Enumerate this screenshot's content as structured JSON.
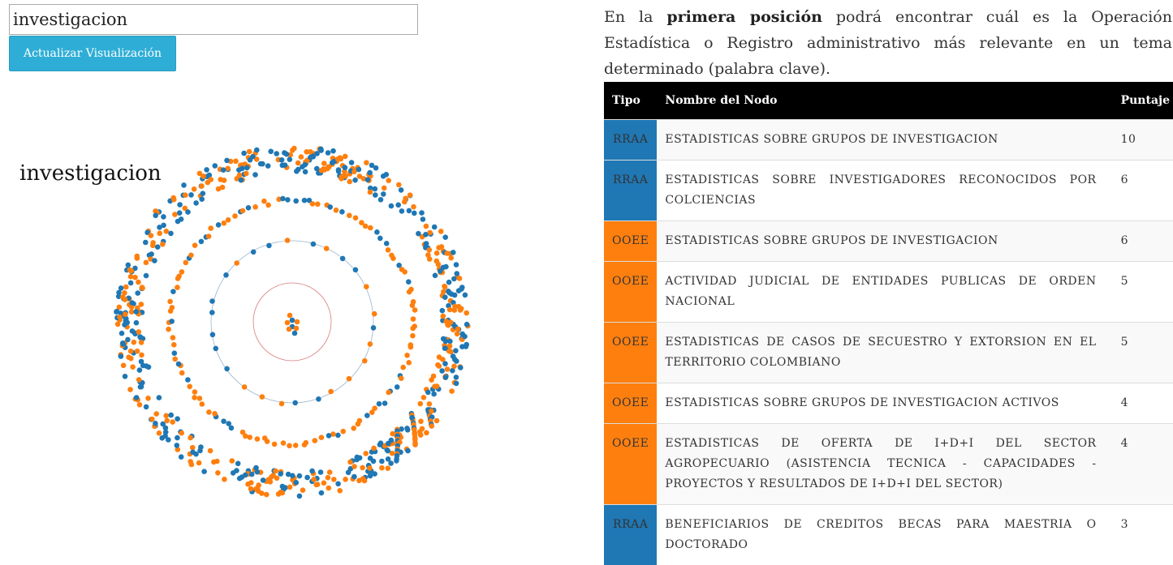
{
  "search": {
    "value": "investigacion"
  },
  "update_button": {
    "label": "Actualizar Visualización"
  },
  "viz": {
    "keyword": "investigacion"
  },
  "intro": {
    "part1": "En la ",
    "bold": "primera posición",
    "part2": " podrá encontrar cuál es la Operación Estadística o Registro administrativo más relevante en un tema determinado (palabra clave)."
  },
  "colors": {
    "rraa": "#1f77b4",
    "ooee": "#ff7f0e",
    "header_bg": "#000000",
    "button": "#2eaed6"
  },
  "table": {
    "headers": {
      "type": "Tipo",
      "name": "Nombre del Nodo",
      "score": "Puntaje"
    },
    "rows": [
      {
        "type": "RRAA",
        "name": "ESTADISTICAS SOBRE GRUPOS DE INVESTIGACION",
        "score": "10"
      },
      {
        "type": "RRAA",
        "name": "ESTADISTICAS SOBRE INVESTIGADORES RECONOCIDOS POR COLCIENCIAS",
        "score": "6"
      },
      {
        "type": "OOEE",
        "name": "ESTADISTICAS SOBRE GRUPOS DE INVESTIGACION",
        "score": "6"
      },
      {
        "type": "OOEE",
        "name": "ACTIVIDAD JUDICIAL DE ENTIDADES PUBLICAS DE ORDEN NACIONAL",
        "score": "5"
      },
      {
        "type": "OOEE",
        "name": "ESTADISTICAS DE CASOS DE SECUESTRO Y EXTORSION EN EL TERRITORIO COLOMBIANO",
        "score": "5"
      },
      {
        "type": "OOEE",
        "name": "ESTADISTICAS SOBRE GRUPOS DE INVESTIGACION ACTIVOS",
        "score": "4"
      },
      {
        "type": "OOEE",
        "name": "ESTADISTICAS DE OFERTA DE I+D+I DEL SECTOR AGROPECUARIO (ASISTENCIA TECNICA - CAPACIDADES - PROYECTOS Y RESULTADOS DE I+D+I DEL SECTOR)",
        "score": "4"
      },
      {
        "type": "RRAA",
        "name": "BENEFICIARIOS DE CREDITOS BECAS PARA MAESTRIA O DOCTORADO",
        "score": "3"
      }
    ]
  }
}
